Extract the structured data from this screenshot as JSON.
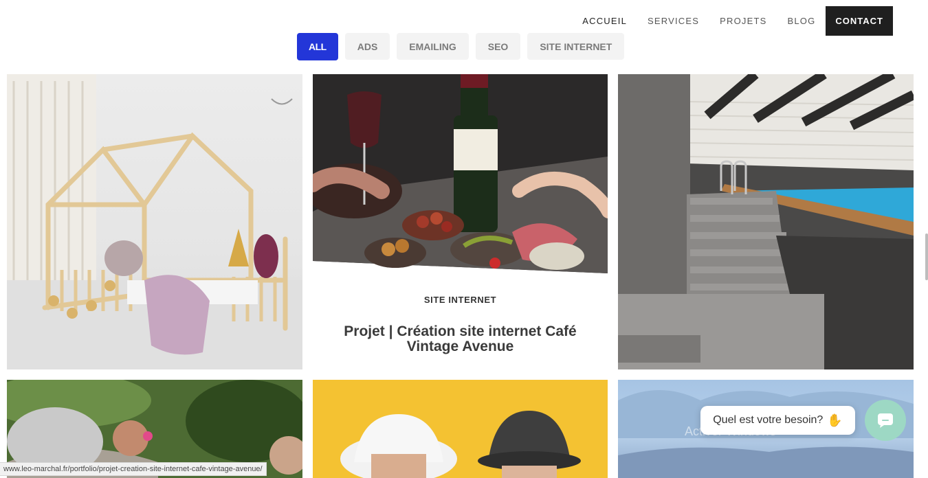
{
  "nav": {
    "items": [
      {
        "label": "ACCUEIL"
      },
      {
        "label": "SERVICES"
      },
      {
        "label": "PROJETS"
      },
      {
        "label": "BLOG"
      }
    ],
    "contact_label": "CONTACT"
  },
  "filters": [
    {
      "label": "ALL",
      "active": true
    },
    {
      "label": "ADS"
    },
    {
      "label": "EMAILING"
    },
    {
      "label": "SEO"
    },
    {
      "label": "SITE INTERNET"
    }
  ],
  "portfolio": {
    "featured": {
      "category": "SITE INTERNET",
      "title": "Projet | Création site internet Café Vintage Avenue"
    }
  },
  "chat": {
    "prompt": "Quel est votre besoin?",
    "emoji_icon": "waving-hand-icon",
    "button_icon": "chat-icon"
  },
  "system": {
    "watermark": "Activer Windows",
    "status_url": "www.leo-marchal.fr/portfolio/projet-creation-site-internet-cafe-vintage-avenue/"
  },
  "colors": {
    "accent": "#2336d8",
    "contact_bg": "#1f1f1f",
    "chat_button": "#9dd8c4"
  }
}
